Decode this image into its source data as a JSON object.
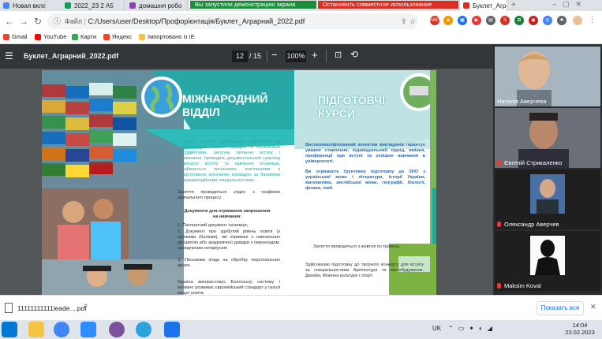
{
  "tabs": [
    {
      "label": "Новая вкладк",
      "color": "#4285f4"
    },
    {
      "label": "2022_23 2 А5",
      "color": "#0f9d58"
    },
    {
      "label": "домашня робо",
      "color": "#8e44ad"
    },
    {
      "label": "Буклет_Агра",
      "color": "#d93025"
    }
  ],
  "share_bar": {
    "stop_demo": "Вы запустили демонстрацию экрана",
    "stop_share": "Остановить совместное использование"
  },
  "address": {
    "label": "Файл",
    "url": "C:/Users/user/Desktop/Профорієнтація/Буклет_Аграрний_2022.pdf"
  },
  "bookmarks": [
    "Gmail",
    "YouTube",
    "Карти",
    "Яндекс",
    "Імпортовано із IE"
  ],
  "pdf": {
    "filename": "Буклет_Аграрний_2022.pdf",
    "page_current": "12",
    "page_total": "/ 15",
    "zoom": "100%"
  },
  "booklet": {
    "left_title": "МІЖНАРОДНИЙ ВІДДІЛ",
    "left_intro": "Відділ «Центр довузівської підготовки та міжнародної освіти» працює з іноземними студентами, регулює питання вступу і навчання, проводить документальний супровід процесу вступу та навчання іноземців, займається питаннями, пов'язаними з підготовкою іноземних громадян за базовими акредитаційними спеціальностями.",
    "left_p2": "Заняття проводяться згідно з графіком навчального процесу.",
    "left_docs_title": "Документи для отримання запрошення на навчання:",
    "left_docs": [
      "1. Паспортний документ іноземця;",
      "2. Документ про здобутий рівень освіти (з оцінками (балами), які отримані з навчальних дисциплін або академічної довідки з перекладом, засвідченим нотаріусом;",
      "3. Письмова згода на обробку персональних даних."
    ],
    "left_tail": "Україна використовує Болонську систему і активно розвиває європейський стандарт у галузі вищої освіти.",
    "right_title": "ПІДГОТОВЧІ КУРСИ",
    "right_p1": "Висококваліфікований колектив викладачів гарантує уважне ставлення, індивідуальний підхід, вміння, преференції при вступі та успішне навчання в університеті.",
    "right_p2": "Ви отримаєте ґрунтовну підготовку до ЗНО з української мови і літератури, історії України, математики, англійської мови, географії, біології, фізики, хімії.",
    "right_p3": "Заняття проводяться з жовтня по травень.",
    "right_p4": "Здійснюємо підготовку до творчого конкурсу для вступу за спеціальностями Архітектура та містобудування, Дизайн, Фізична культура і спорт."
  },
  "participants": [
    {
      "name": "Наталія Аверчева",
      "muted": false
    },
    {
      "name": "Євгеній Стрикаленко",
      "muted": true
    },
    {
      "name": "Олександр Аверчев",
      "muted": true
    },
    {
      "name": "Maksim Koval",
      "muted": true
    }
  ],
  "download": {
    "file": "11111111111leade....pdf",
    "show_all": "Показать все"
  },
  "taskbar": {
    "lang": "UK",
    "time": "14:04",
    "date": "23.02.2023"
  },
  "colors": {
    "accent": "#1a73e8",
    "teal": "#27a8a6",
    "stop_red": "#d93025",
    "stop_green": "#1e8e3e"
  }
}
